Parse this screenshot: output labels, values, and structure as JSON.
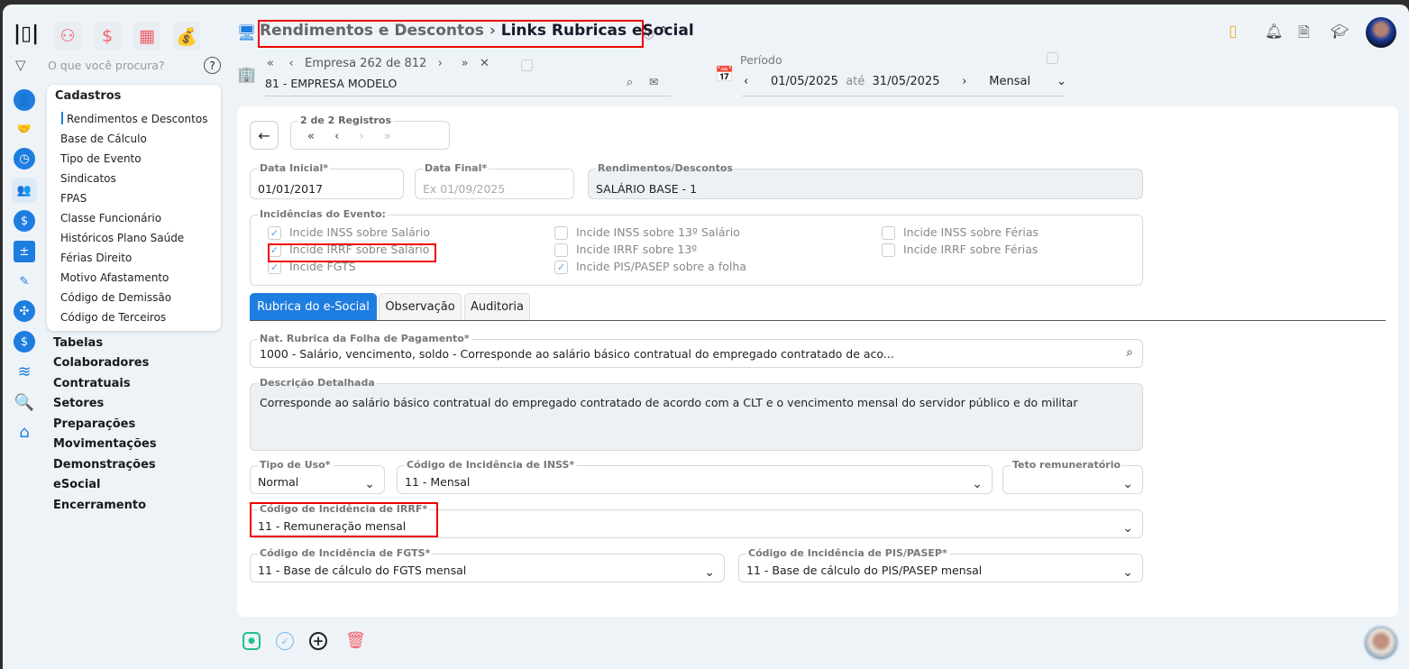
{
  "header": {
    "crumb_parent": "Rendimentos e Descontos",
    "crumb_sep": "›",
    "crumb_current": "Links Rubricas eSocial",
    "search_placeholder": "O que você procura?"
  },
  "empresa": {
    "nav_label": "Empresa 262 de 812",
    "value": "81 - EMPRESA MODELO"
  },
  "periodo": {
    "label": "Período",
    "start": "01/05/2025",
    "sep": "até",
    "end": "31/05/2025",
    "type": "Mensal"
  },
  "menu": {
    "title": "Cadastros",
    "items": [
      "Rendimentos e Descontos",
      "Base de Cálculo",
      "Tipo de Evento",
      "Sindicatos",
      "FPAS",
      "Classe Funcionário",
      "Históricos Plano Saúde",
      "Férias Direito",
      "Motivo Afastamento",
      "Código de Demissão",
      "Código de Terceiros"
    ],
    "sections": [
      "Tabelas",
      "Colaboradores",
      "Contratuais",
      "Setores",
      "Preparações",
      "Movimentações",
      "Demonstrações",
      "eSocial",
      "Encerramento"
    ]
  },
  "records": {
    "label": "2 de 2 Registros"
  },
  "form": {
    "data_inicial": {
      "label": "Data Inicial*",
      "value": "01/01/2017"
    },
    "data_final": {
      "label": "Data Final*",
      "placeholder": "Ex 01/09/2025"
    },
    "rend": {
      "label": "Rendimentos/Descontos",
      "value": "SALÁRIO BASE - 1"
    },
    "incid_title": "Incidências do Evento:",
    "checks": [
      {
        "label": "Incide INSS sobre Salário",
        "checked": true
      },
      {
        "label": "Incide IRRF sobre Salário",
        "checked": true
      },
      {
        "label": "Incide FGTS",
        "checked": true
      },
      {
        "label": "Incide INSS sobre 13º Salário",
        "checked": false
      },
      {
        "label": "Incide IRRF sobre 13º",
        "checked": false
      },
      {
        "label": "Incide PIS/PASEP sobre a folha",
        "checked": true
      },
      {
        "label": "Incide INSS sobre Férias",
        "checked": false
      },
      {
        "label": "Incide IRRF sobre Férias",
        "checked": false
      }
    ],
    "tabs": [
      "Rubrica do e-Social",
      "Observação",
      "Auditoria"
    ],
    "nat": {
      "label": "Nat. Rubrica da Folha de Pagamento*",
      "value": "1000 - Salário, vencimento, soldo - Corresponde ao salário básico contratual do empregado contratado de aco..."
    },
    "desc": {
      "label": "Descrição Detalhada",
      "value": "Corresponde ao salário básico contratual do empregado contratado de acordo com a CLT e o vencimento mensal do servidor público e do militar"
    },
    "tipo_uso": {
      "label": "Tipo de Uso*",
      "value": "Normal"
    },
    "inss": {
      "label": "Código de Incidência de INSS*",
      "value": "11 - Mensal"
    },
    "teto": {
      "label": "Teto remuneratório",
      "value": ""
    },
    "irrf": {
      "label": "Código de Incidência de IRRF*",
      "value": "11 - Remuneração mensal"
    },
    "fgts": {
      "label": "Código de Incidência de FGTS*",
      "value": "11 - Base de cálculo do FGTS mensal"
    },
    "pis": {
      "label": "Código de Incidência de PIS/PASEP*",
      "value": "11 - Base de cálculo do PIS/PASEP mensal"
    }
  }
}
